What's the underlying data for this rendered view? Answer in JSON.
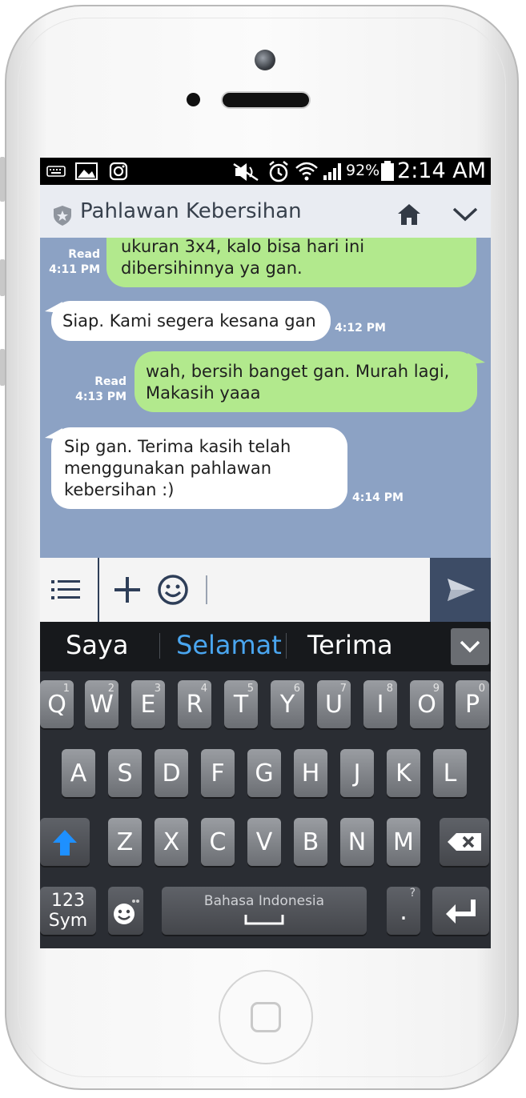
{
  "status_bar": {
    "battery": "92%",
    "time": "2:14 AM",
    "left_icons": [
      "keyboard-icon",
      "image-icon",
      "instagram-icon"
    ],
    "right_icons": [
      "mute-icon",
      "alarm-icon",
      "wifi-icon",
      "signal-icon",
      "battery-icon"
    ]
  },
  "header": {
    "title": "Pahlawan Kebersihan",
    "icons": [
      "shield-icon",
      "home-icon",
      "chevron-down-icon"
    ]
  },
  "chat": {
    "messages": [
      {
        "from": "me",
        "text_lines": [
          "ukuran 3x4, kalo bisa hari ini",
          "dibersihinnya ya gan."
        ],
        "status": "Read",
        "time": "4:11 PM"
      },
      {
        "from": "them",
        "text_lines": [
          "Siap. Kami segera kesana gan"
        ],
        "time": "4:12 PM"
      },
      {
        "from": "me",
        "text_lines": [
          "wah, bersih banget gan. Murah lagi,",
          "Makasih yaaa"
        ],
        "status": "Read",
        "time": "4:13 PM"
      },
      {
        "from": "them",
        "text_lines": [
          "Sip gan. Terima kasih telah",
          "menggunakan pahlawan",
          "kebersihan :)"
        ],
        "time": "4:14 PM"
      }
    ]
  },
  "input_bar": {
    "icons": [
      "menu-icon",
      "plus-icon",
      "emoji-icon",
      "send-icon"
    ],
    "value": ""
  },
  "keyboard": {
    "suggestions": [
      "Saya",
      "Selamat",
      "Terima"
    ],
    "row1": [
      {
        "key": "Q",
        "hint": "1"
      },
      {
        "key": "W",
        "hint": "2"
      },
      {
        "key": "E",
        "hint": "3"
      },
      {
        "key": "R",
        "hint": "4"
      },
      {
        "key": "T",
        "hint": "5"
      },
      {
        "key": "Y",
        "hint": "6"
      },
      {
        "key": "U",
        "hint": "7"
      },
      {
        "key": "I",
        "hint": "8"
      },
      {
        "key": "O",
        "hint": "9"
      },
      {
        "key": "P",
        "hint": "0"
      }
    ],
    "row2": [
      "A",
      "S",
      "D",
      "F",
      "G",
      "H",
      "J",
      "K",
      "L"
    ],
    "row3": [
      "Z",
      "X",
      "C",
      "V",
      "B",
      "N",
      "M"
    ],
    "sym_label_1": "123",
    "sym_label_2": "Sym",
    "space_label": "Bahasa Indonesia",
    "period_key": ".",
    "period_hint": "?",
    "accent_color": "#1e90ff"
  }
}
